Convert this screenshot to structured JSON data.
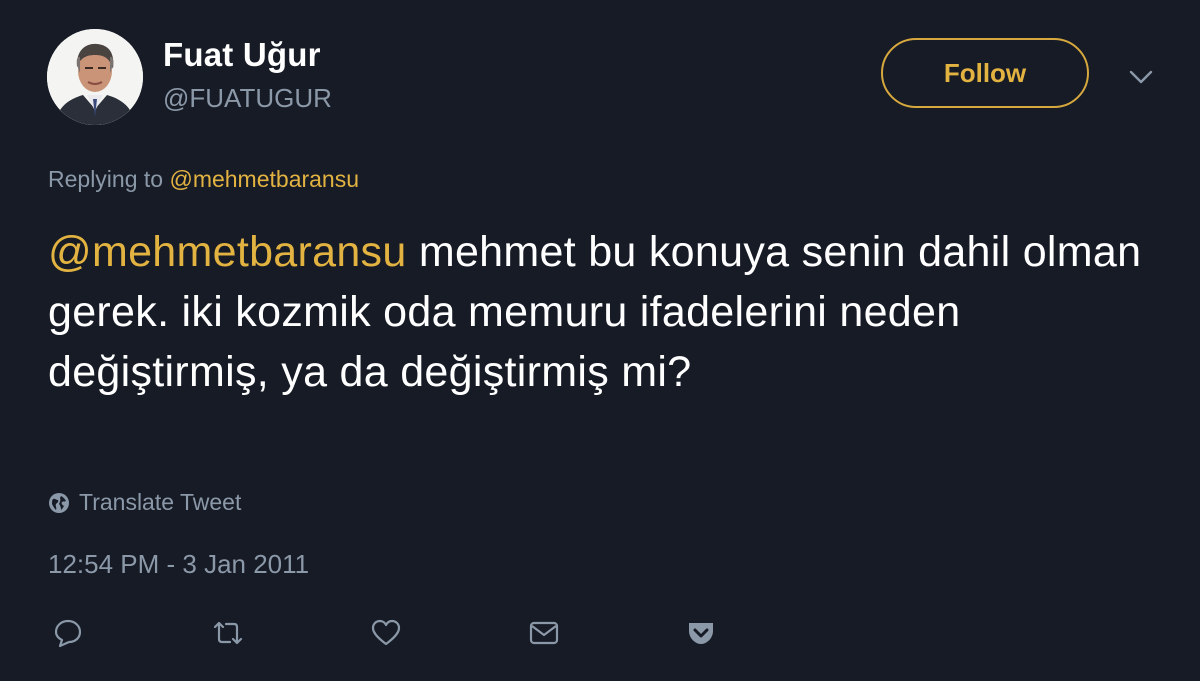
{
  "user": {
    "name": "Fuat Uğur",
    "handle": "@FUATUGUR"
  },
  "follow_label": "Follow",
  "reply_context": {
    "prefix": "Replying to",
    "mention": "@mehmetbaransu"
  },
  "tweet": {
    "mention": "@mehmetbaransu",
    "text": " mehmet bu konuya senin dahil olman gerek. iki kozmik oda memuru ifadelerini neden değiştirmiş, ya da değiştirmiş mi?"
  },
  "translate_label": "Translate Tweet",
  "timestamp": "12:54 PM - 3 Jan 2011",
  "icons": {
    "menu": "chevron-down-icon",
    "translate": "globe-icon",
    "actions": [
      "reply-icon",
      "retweet-icon",
      "like-icon",
      "message-icon",
      "pocket-icon"
    ]
  },
  "colors": {
    "background": "#161b26",
    "accent": "#e3b341",
    "muted": "#8b98a8",
    "text": "#ffffff"
  }
}
